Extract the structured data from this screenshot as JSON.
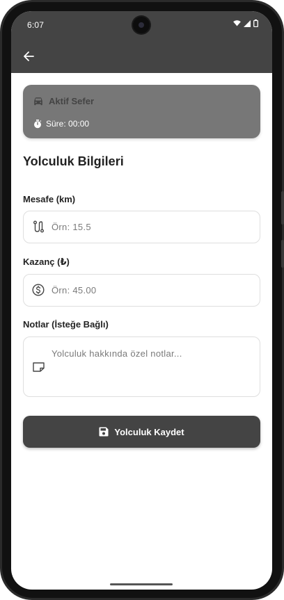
{
  "status_bar": {
    "time": "6:07"
  },
  "app_bar": {
    "back_icon": "arrow-back-icon"
  },
  "active_trip": {
    "icon": "car-icon",
    "title": "Aktif Sefer",
    "timer_icon": "stopwatch-icon",
    "timer_text": "Süre: 00:00"
  },
  "form": {
    "title": "Yolculuk Bilgileri",
    "distance": {
      "label": "Mesafe (km)",
      "placeholder": "Örn: 15.5",
      "icon": "route-icon"
    },
    "earnings": {
      "label": "Kazanç (₺)",
      "placeholder": "Örn: 45.00",
      "icon": "dollar-circle-icon"
    },
    "notes": {
      "label": "Notlar (İsteğe Bağlı)",
      "placeholder": "Yolculuk hakkında özel notlar...",
      "icon": "note-icon"
    },
    "save_button": {
      "label": "Yolculuk Kaydet",
      "icon": "save-icon"
    }
  },
  "colors": {
    "app_bar": "#444444",
    "active_card": "#777777",
    "button": "#444444"
  }
}
